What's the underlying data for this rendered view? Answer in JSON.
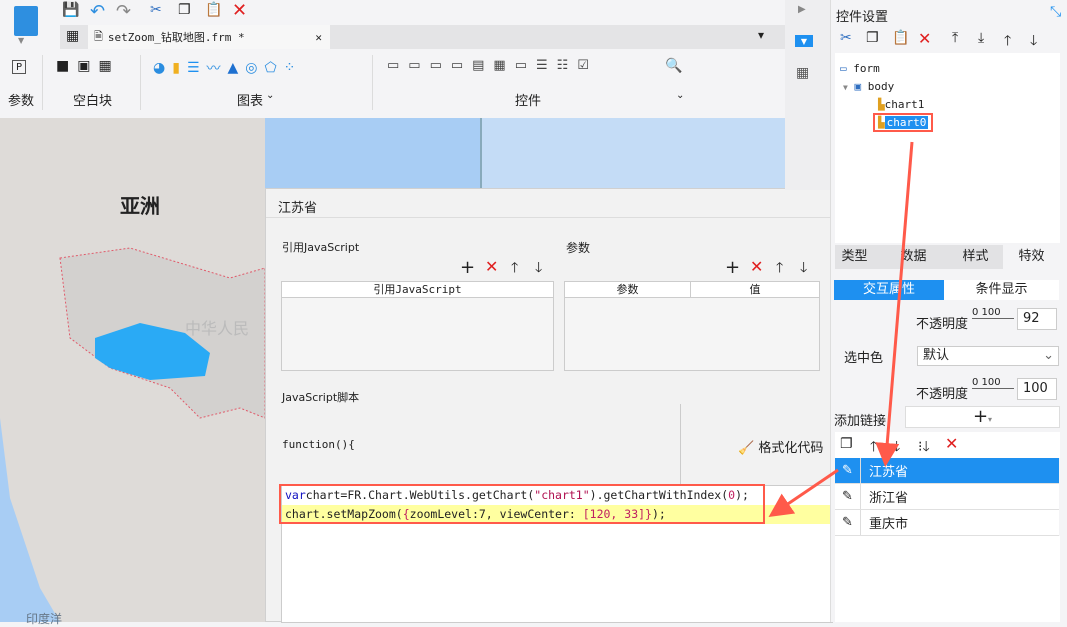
{
  "toolbar": {
    "tab_title": "setZoom_钻取地图.frm *",
    "groups": [
      "参数",
      "空白块",
      "图表",
      "控件"
    ]
  },
  "map": {
    "label_asia": "亚洲",
    "label_china": "中华人民",
    "label_ocean": "印度洋"
  },
  "dialog": {
    "title": "江苏省",
    "ref_js_title": "引用JavaScript",
    "params_title": "参数",
    "ref_js_col": "引用JavaScript",
    "param_col": "参数",
    "value_col": "值",
    "script_title": "JavaScript脚本",
    "function_header": "function(){",
    "format_label": "格式化代码",
    "code_lines": [
      [
        [
          "kw",
          "var"
        ],
        [
          "",
          "chart=FR.Chart.WebUtils.getChart("
        ],
        [
          "str",
          "\"chart1\""
        ],
        [
          "",
          ").getChartWithIndex("
        ],
        [
          "num",
          "0"
        ],
        [
          "",
          ");"
        ]
      ],
      [
        [
          "",
          "chart.setMapZoom("
        ],
        [
          "num",
          "{"
        ],
        [
          "",
          "zoomLevel:7, viewCenter: "
        ],
        [
          "num",
          "[120, 33]"
        ],
        [
          "num",
          "}"
        ],
        [
          "",
          ");"
        ]
      ]
    ]
  },
  "right_panel": {
    "title": "控件设置",
    "tree": [
      {
        "label": "form"
      },
      {
        "label": "body"
      },
      {
        "label": "chart1"
      },
      {
        "label": "chart0",
        "selected": true
      }
    ],
    "tabs": [
      "类型",
      "数据",
      "样式",
      "特效"
    ],
    "active_tab": "特效",
    "subtabs": [
      "交互属性",
      "条件显示"
    ],
    "active_subtab": "交互属性",
    "opacity_label": "不透明度",
    "slider_scale": "0 100",
    "opacity1": "92",
    "selected_color_label": "选中色",
    "selected_color_value": "默认",
    "opacity2": "100",
    "add_link_label": "添加链接",
    "links": [
      {
        "label": "江苏省",
        "selected": true
      },
      {
        "label": "浙江省"
      },
      {
        "label": "重庆市"
      }
    ]
  },
  "colors": {
    "accent": "#1e90f0",
    "highlight": "#ff5a4a",
    "code_bg": "#ffffa0",
    "map_ocean": "#a8cdf4",
    "map_land": "#d9d6d4",
    "map_region": "#2aaaf5"
  }
}
